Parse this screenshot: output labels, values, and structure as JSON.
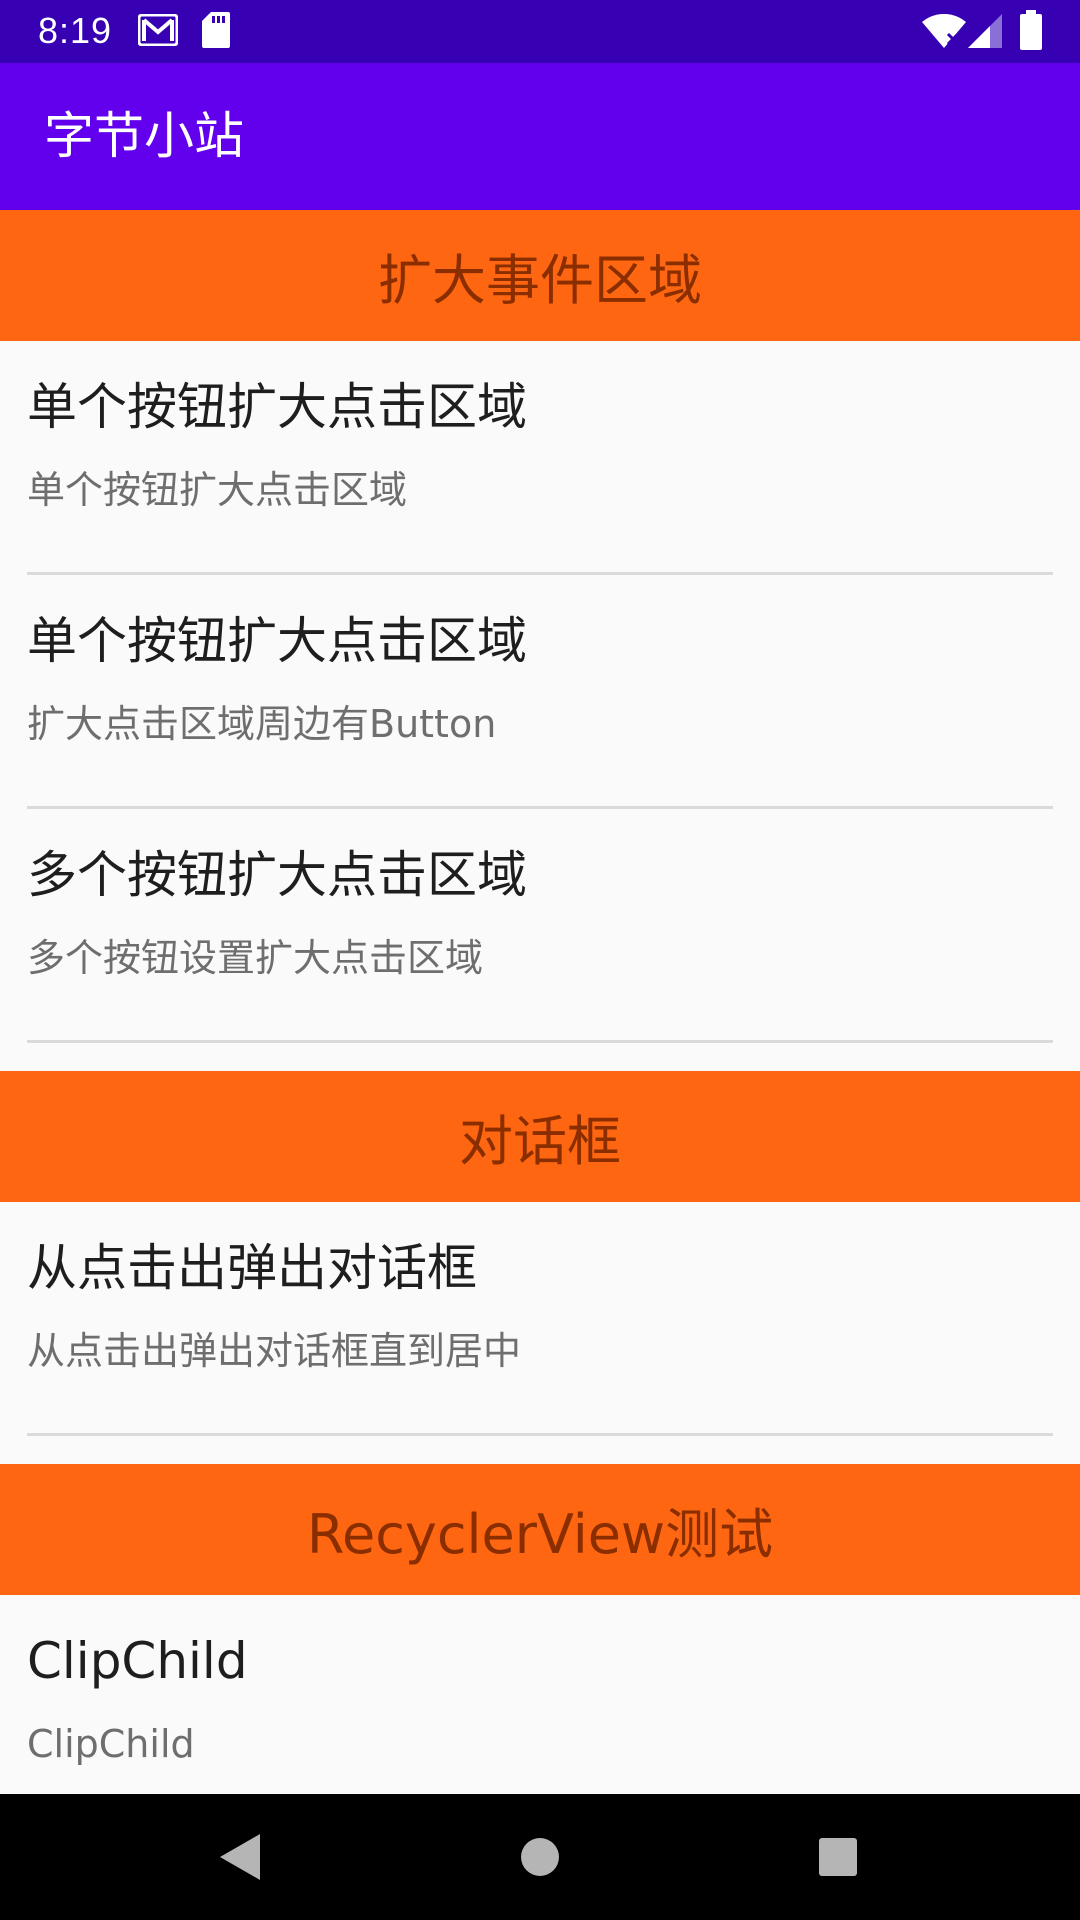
{
  "status_bar": {
    "time": "8:19",
    "left_icons": [
      "gmail-icon",
      "sd-card-icon"
    ],
    "right_icons": [
      "wifi-icon",
      "signal-icon",
      "battery-icon"
    ]
  },
  "app_bar": {
    "title": "字节小站"
  },
  "sections": [
    {
      "header": "扩大事件区域",
      "items": [
        {
          "title": "单个按钮扩大点击区域",
          "subtitle": "单个按钮扩大点击区域"
        },
        {
          "title": "单个按钮扩大点击区域",
          "subtitle": "扩大点击区域周边有Button"
        },
        {
          "title": "多个按钮扩大点击区域",
          "subtitle": "多个按钮设置扩大点击区域"
        }
      ]
    },
    {
      "header": "对话框",
      "items": [
        {
          "title": "从点击出弹出对话框",
          "subtitle": "从点击出弹出对话框直到居中"
        }
      ]
    },
    {
      "header": "RecyclerView测试",
      "items": [
        {
          "title": "ClipChild",
          "subtitle": "ClipChild"
        }
      ]
    }
  ],
  "nav_bar": {
    "buttons": [
      "back-icon",
      "home-icon",
      "recents-icon"
    ]
  },
  "colors": {
    "status_bar": "#3700B3",
    "app_bar": "#6200EE",
    "section_header_bg": "#FF6611",
    "section_header_text": "#8A2E00",
    "background": "#FAFAFA"
  }
}
